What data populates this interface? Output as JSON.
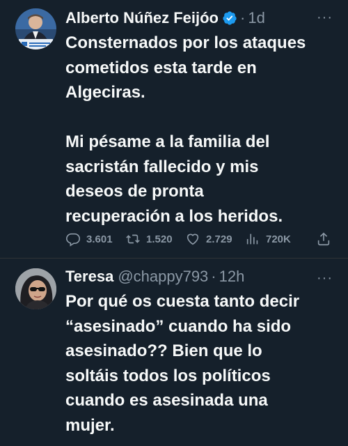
{
  "tweets": [
    {
      "author": "Alberto Núñez Feijóo",
      "verified": true,
      "separator": "·",
      "time": "1d",
      "more": "···",
      "text": "Consternados por los ataques\ncometidos esta tarde en\nAlgeciras.\n\nMi pésame a la familia del\nsacristán fallecido y mis\ndeseos de pronta\nrecuperación a los heridos.",
      "stats": {
        "replies": "3.601",
        "retweets": "1.520",
        "likes": "2.729",
        "views": "720K"
      }
    },
    {
      "author": "Teresa",
      "handle": "@chappy793",
      "separator": "·",
      "time": "12h",
      "more": "···",
      "text": "Por qué os cuesta tanto decir\n“asesinado” cuando ha sido\nasesinado?? Bien que lo\nsoltáis todos los políticos\ncuando es asesinada una\nmujer."
    }
  ],
  "colors": {
    "background": "#15202b",
    "text": "#f7f9f9",
    "muted": "#8b98a5",
    "verified": "#1d9bf0"
  }
}
